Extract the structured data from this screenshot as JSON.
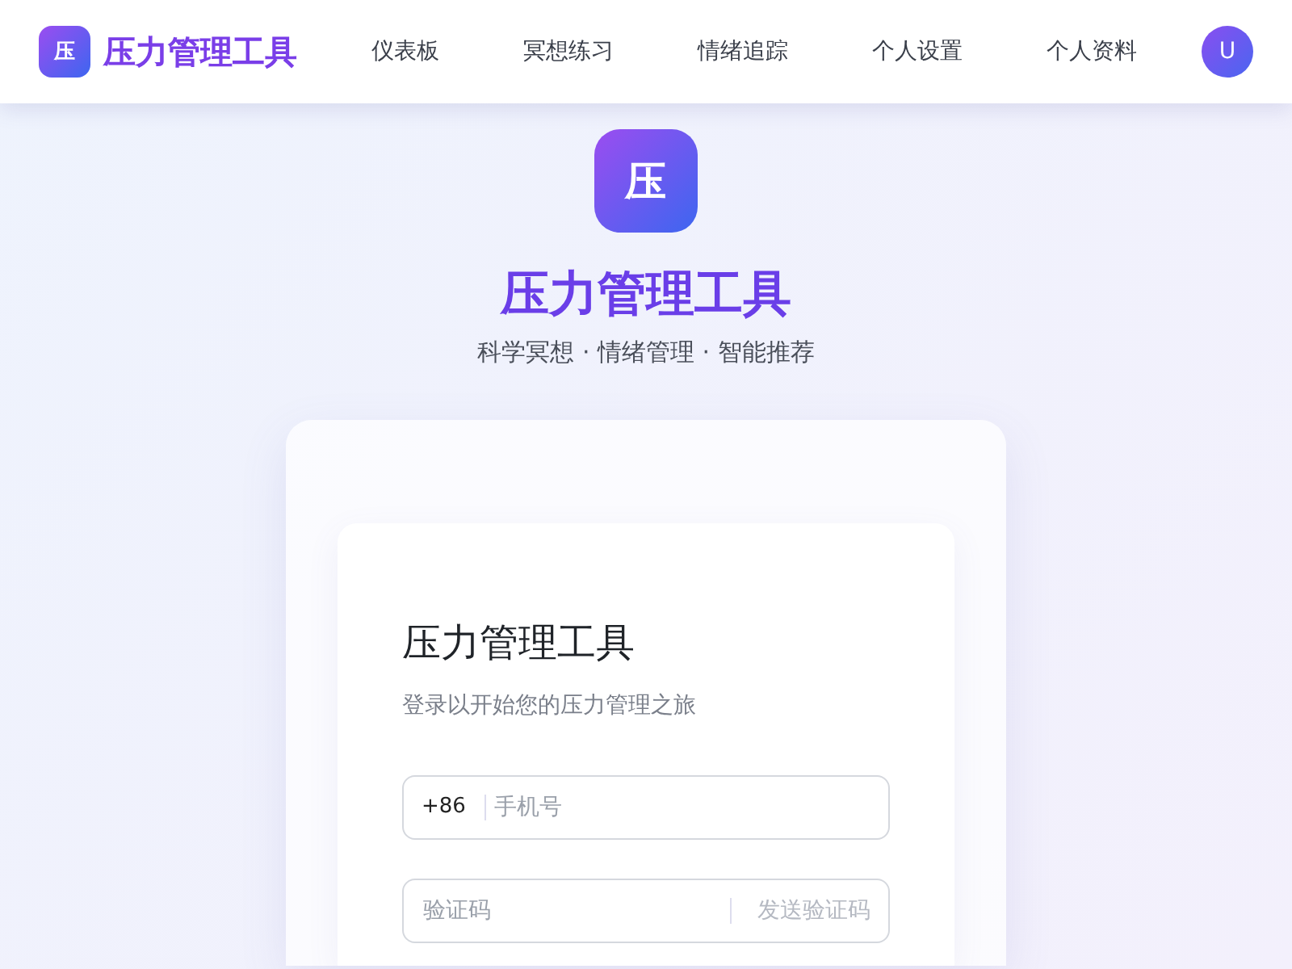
{
  "header": {
    "logo_mark": "压",
    "brand": "压力管理工具",
    "nav": [
      {
        "label": "仪表板",
        "selected": false
      },
      {
        "label": "冥想练习",
        "selected": false
      },
      {
        "label": "情绪追踪",
        "selected": false
      },
      {
        "label": "个人设置",
        "selected": false
      },
      {
        "label": "个人资料",
        "selected": false
      }
    ],
    "avatar": "U"
  },
  "hero": {
    "logo_mark": "压",
    "title": "压力管理工具",
    "tagline": "科学冥想 · 情绪管理 · 智能推荐"
  },
  "login": {
    "title": "压力管理工具",
    "subtitle": "登录以开始您的压力管理之旅",
    "phone": {
      "prefix": "+86",
      "placeholder": "手机号"
    },
    "code": {
      "placeholder": "验证码",
      "send_button": "发送验证码",
      "disabled": true
    }
  }
}
